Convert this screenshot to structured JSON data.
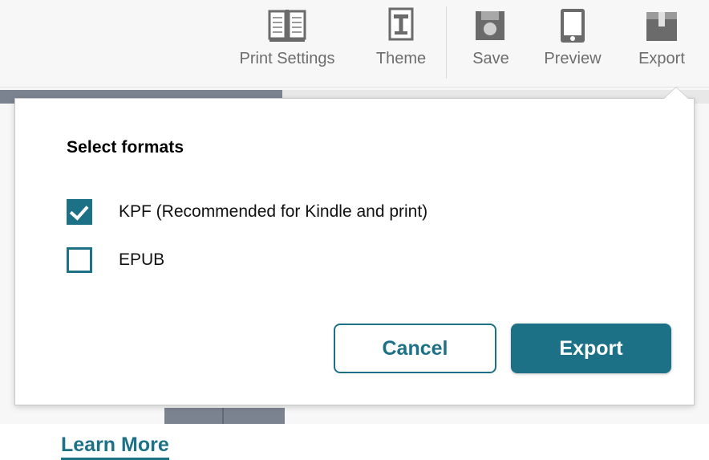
{
  "toolbar": {
    "items": [
      {
        "id": "print-settings",
        "label": "Print Settings",
        "icon": "open-book-icon"
      },
      {
        "id": "theme",
        "label": "Theme",
        "icon": "text-theme-icon"
      },
      {
        "id": "save",
        "label": "Save",
        "icon": "floppy-disk-icon"
      },
      {
        "id": "preview",
        "label": "Preview",
        "icon": "tablet-device-icon"
      },
      {
        "id": "export",
        "label": "Export",
        "icon": "package-box-icon"
      }
    ]
  },
  "dialog": {
    "title": "Select formats",
    "formats": [
      {
        "id": "kpf",
        "label": "KPF (Recommended for Kindle and print)",
        "checked": true
      },
      {
        "id": "epub",
        "label": "EPUB",
        "checked": false
      }
    ],
    "learn_more_label": "Learn More",
    "cancel_label": "Cancel",
    "export_label": "Export"
  },
  "colors": {
    "accent_teal": "#1d7186",
    "toolbar_label": "#6d6d6d",
    "icon_gray": "#6b6b6b",
    "strip_gray": "#7b8391",
    "dialog_background": "#ffffff"
  }
}
